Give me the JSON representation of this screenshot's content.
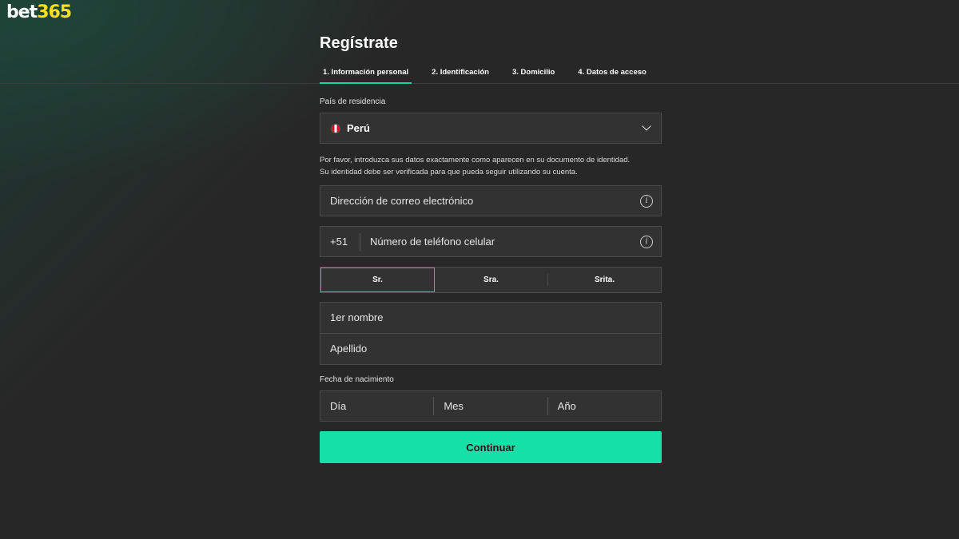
{
  "brand": {
    "logo_part1": "bet",
    "logo_part2": "365"
  },
  "page": {
    "title": "Regístrate"
  },
  "tabs": [
    {
      "label": "1. Información personal",
      "active": true
    },
    {
      "label": "2. Identificación",
      "active": false
    },
    {
      "label": "3. Domicilio",
      "active": false
    },
    {
      "label": "4. Datos de acceso",
      "active": false
    }
  ],
  "form": {
    "country_label": "País de residencia",
    "country_value": "Perú",
    "notice_line1": "Por favor, introduzca sus datos exactamente como aparecen en su documento de identidad.",
    "notice_line2": "Su identidad debe ser verificada para que pueda seguir utilizando su cuenta.",
    "email_placeholder": "Dirección de correo electrónico",
    "phone_prefix": "+51",
    "phone_placeholder": "Número de teléfono celular",
    "titles": [
      {
        "label": "Sr.",
        "selected": true
      },
      {
        "label": "Sra.",
        "selected": false
      },
      {
        "label": "Srita.",
        "selected": false
      }
    ],
    "first_name_placeholder": "1er nombre",
    "last_name_placeholder": "Apellido",
    "dob_label": "Fecha de nacimiento",
    "dob_day": "Día",
    "dob_month": "Mes",
    "dob_year": "Año",
    "submit_label": "Continuar"
  },
  "icons": {
    "country_flag": "peru-flag-icon",
    "dropdown": "chevron-down-icon",
    "info": "info-icon"
  },
  "colors": {
    "accent": "#14e0a7",
    "logo_yellow": "#ffdf1b",
    "background": "#272727"
  }
}
